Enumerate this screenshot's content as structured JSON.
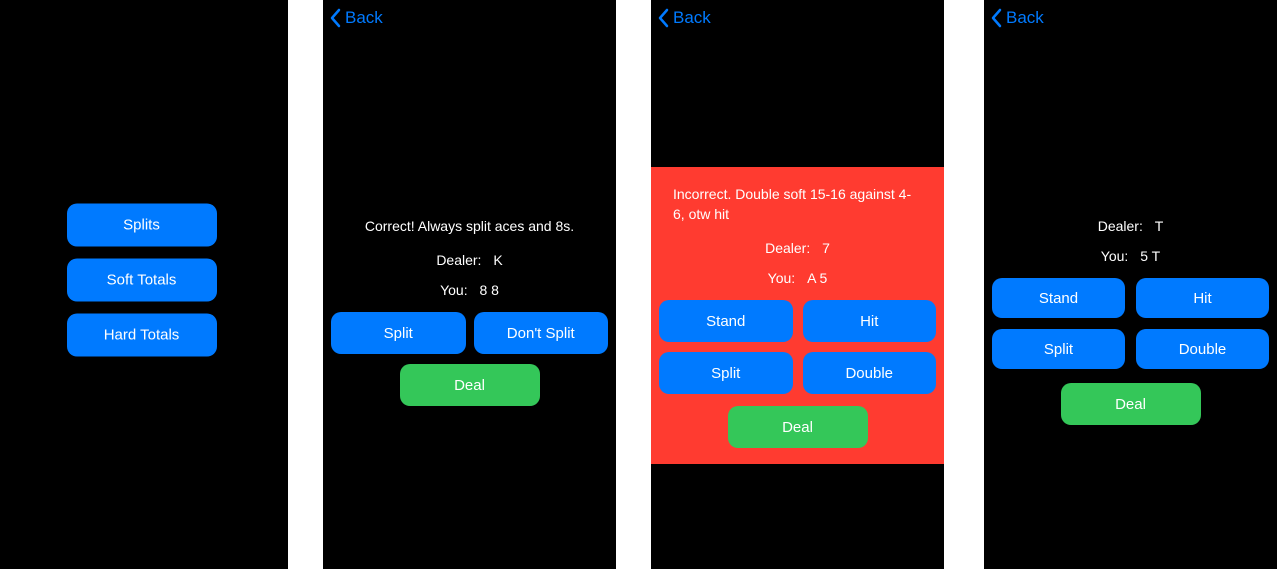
{
  "nav": {
    "back_label": "Back"
  },
  "screen1": {
    "menu": {
      "splits": "Splits",
      "soft_totals": "Soft Totals",
      "hard_totals": "Hard Totals"
    }
  },
  "screen2": {
    "feedback": "Correct! Always split aces and 8s.",
    "dealer_label": "Dealer:",
    "dealer_value": "K",
    "you_label": "You:",
    "you_value": "8  8",
    "actions": {
      "split": "Split",
      "dont_split": "Don't Split",
      "deal": "Deal"
    }
  },
  "screen3": {
    "feedback": "Incorrect. Double soft 15-16 against 4-6, otw hit",
    "dealer_label": "Dealer:",
    "dealer_value": "7",
    "you_label": "You:",
    "you_value": "A  5",
    "actions": {
      "stand": "Stand",
      "hit": "Hit",
      "split": "Split",
      "double": "Double",
      "deal": "Deal"
    }
  },
  "screen4": {
    "dealer_label": "Dealer:",
    "dealer_value": "T",
    "you_label": "You:",
    "you_value": "5  T",
    "actions": {
      "stand": "Stand",
      "hit": "Hit",
      "split": "Split",
      "double": "Double",
      "deal": "Deal"
    }
  }
}
